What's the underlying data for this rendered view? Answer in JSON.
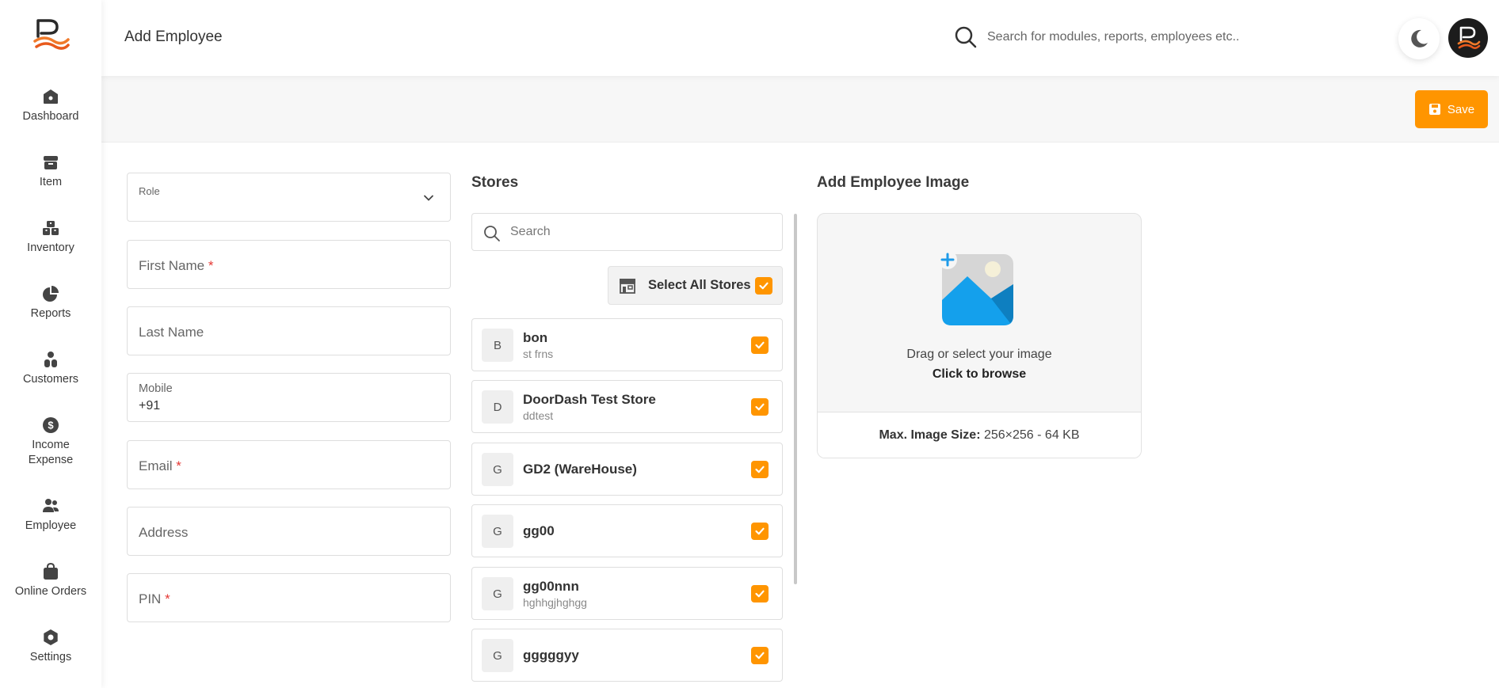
{
  "sidebar": {
    "items": [
      {
        "label": "Dashboard",
        "icon": "home-icon"
      },
      {
        "label": "Item",
        "icon": "box-icon"
      },
      {
        "label": "Inventory",
        "icon": "inventory-icon"
      },
      {
        "label": "Reports",
        "icon": "pie-chart-icon"
      },
      {
        "label": "Customers",
        "icon": "customers-icon"
      },
      {
        "label": "Income",
        "label2": "Expense",
        "icon": "dollar-icon"
      },
      {
        "label": "Employee",
        "icon": "employee-icon"
      },
      {
        "label": "Online Orders",
        "icon": "shopping-bag-icon"
      },
      {
        "label": "Settings",
        "icon": "gear-icon"
      }
    ]
  },
  "header": {
    "title": "Add Employee",
    "search_placeholder": "Search for modules, reports, employees etc.."
  },
  "toolbar": {
    "save_label": "Save"
  },
  "form": {
    "role_label": "Role",
    "first_name_label": "First Name",
    "last_name_label": "Last Name",
    "mobile_label": "Mobile",
    "mobile_value": "+91",
    "email_label": "Email",
    "address_label": "Address",
    "pin_label": "PIN",
    "required_mark": "*"
  },
  "stores": {
    "title": "Stores",
    "search_placeholder": "Search",
    "select_all_label": "Select All Stores",
    "select_all_checked": true,
    "list": [
      {
        "initial": "B",
        "name": "bon",
        "sub": "st frns",
        "checked": true
      },
      {
        "initial": "D",
        "name": "DoorDash Test Store",
        "sub": "ddtest",
        "checked": true
      },
      {
        "initial": "G",
        "name": "GD2 (WareHouse)",
        "sub": "",
        "checked": true
      },
      {
        "initial": "G",
        "name": "gg00",
        "sub": "",
        "checked": true
      },
      {
        "initial": "G",
        "name": "gg00nnn",
        "sub": "hghhgjhghgg",
        "checked": true
      },
      {
        "initial": "G",
        "name": "gggggyy",
        "sub": "",
        "checked": true
      }
    ]
  },
  "image_upload": {
    "title": "Add Employee Image",
    "hint": "Drag or select your image",
    "browse_label": "Click to browse",
    "max_size_label": "Max. Image Size:",
    "max_size_value": "256×256 - 64 KB"
  },
  "colors": {
    "accent": "#ff9500",
    "required": "#e53935",
    "image_blue": "#1e9be9"
  }
}
